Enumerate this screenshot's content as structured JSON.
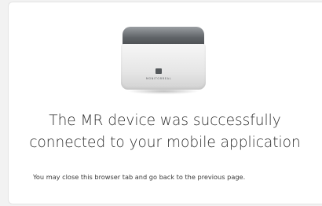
{
  "device": {
    "brand_text": "MONITORREAL",
    "logo_text": "MR"
  },
  "message": {
    "title_line1": "The MR device was successfully",
    "title_line2": "connected to your mobile application",
    "subtext": "You may close this browser tab and go back to the previous page."
  },
  "colors": {
    "page_background": "#f2f2f2",
    "card_background": "#ffffff",
    "title_text": "#2f2f2f"
  }
}
